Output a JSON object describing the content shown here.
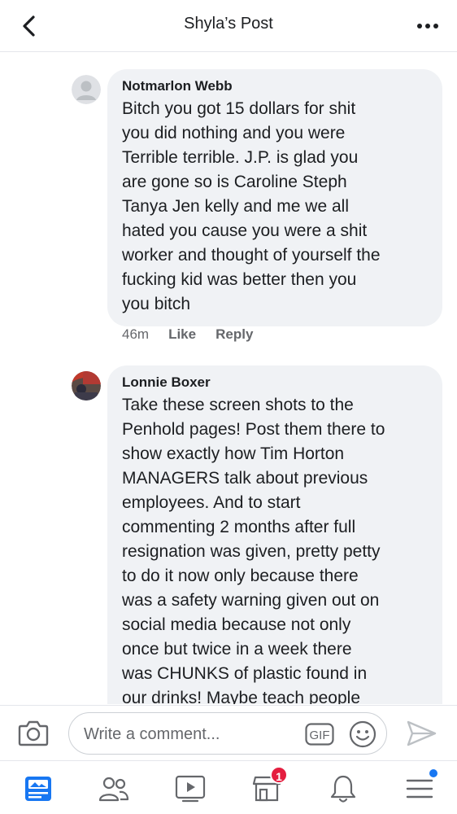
{
  "header": {
    "title": "Shyla’s Post",
    "back_icon": "chevron-left-icon",
    "more_icon": "more-horizontal-icon"
  },
  "comments": [
    {
      "author": "Notmarlon Webb",
      "text": "Bitch you got 15 dollars for shit\nyou did nothing and you were\nTerrible terrible.  J.P. is glad you\nare gone so is Caroline Steph\nTanya Jen kelly and me we all\nhated you cause you were a shit\nworker and thought of yourself the\nfucking kid was better then you\nyou bitch",
      "time": "46m",
      "like_label": "Like",
      "reply_label": "Reply"
    },
    {
      "author": "Lonnie Boxer",
      "text": "Take these screen shots to the\nPenhold pages! Post them there to\nshow exactly how Tim Horton\nMANAGERS talk about previous\nemployees. And to start\ncommenting 2 months after full\nresignation was given, pretty petty\nto do it now only because there\nwas a safety warning given out on\nsocial media because not only\nonce but twice in a week there\nwas CHUNKS of plastic found in\nour drinks! Maybe teach people"
    }
  ],
  "composer": {
    "placeholder": "Write a comment...",
    "gif_label": "GIF",
    "camera_icon": "camera-icon",
    "emoji_icon": "emoji-icon",
    "send_icon": "send-icon"
  },
  "tabbar": {
    "items": [
      {
        "icon": "news-feed-icon",
        "active": true
      },
      {
        "icon": "friends-icon"
      },
      {
        "icon": "watch-icon"
      },
      {
        "icon": "marketplace-icon",
        "badge": "1"
      },
      {
        "icon": "notifications-icon"
      },
      {
        "icon": "menu-icon",
        "dot": true
      }
    ]
  },
  "colors": {
    "accent": "#1877f2",
    "bubble": "#f0f2f5",
    "secondary_text": "#65676b",
    "badge": "#e41e3f"
  }
}
